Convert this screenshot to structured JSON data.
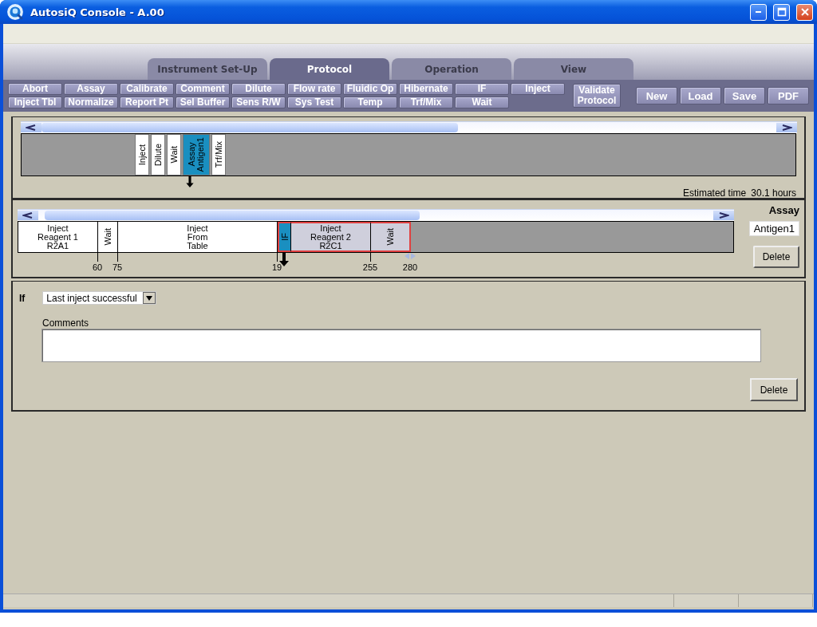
{
  "window": {
    "title": "AutosiQ Console - A.00"
  },
  "tabs": [
    {
      "label": "Instrument Set-Up",
      "selected": false
    },
    {
      "label": "Protocol",
      "selected": true
    },
    {
      "label": "Operation",
      "selected": false
    },
    {
      "label": "View",
      "selected": false
    }
  ],
  "step_buttons": [
    "Abort",
    "Assay",
    "Calibrate",
    "Comment",
    "Dilute",
    "Flow rate",
    "Fluidic Op",
    "Hibernate",
    "IF",
    "Inject",
    "Inject Tbl",
    "Normalize",
    "Report Pt",
    "Sel Buffer",
    "Sens R/W",
    "Sys Test",
    "Temp",
    "Trf/Mix",
    "Wait"
  ],
  "validate_button": "Validate Protocol",
  "file_buttons": [
    "New",
    "Load",
    "Save",
    "PDF"
  ],
  "protocol_timeline": {
    "steps": [
      {
        "lines": [
          "Inject"
        ],
        "selected": false
      },
      {
        "lines": [
          "Dilute"
        ],
        "selected": false
      },
      {
        "lines": [
          "Wait"
        ],
        "selected": false
      },
      {
        "lines": [
          "Assay",
          "Antigen1"
        ],
        "selected": true
      },
      {
        "lines": [
          "Trf/Mix"
        ],
        "selected": false
      }
    ],
    "estimated_time_label": "Estimated time",
    "estimated_time": "30.1 hours"
  },
  "assay_timeline": {
    "steps": [
      {
        "kind": "block",
        "lines": [
          "Inject",
          "Reagent 1",
          "R2A1"
        ],
        "selected": false,
        "highlighted": false,
        "end_tick": "60"
      },
      {
        "kind": "vertical",
        "lines": [
          "Wait"
        ],
        "selected": false,
        "highlighted": false,
        "end_tick": "75"
      },
      {
        "kind": "block",
        "lines": [
          "Inject",
          "From",
          "Table"
        ],
        "selected": false,
        "highlighted": false,
        "end_tick": "19"
      },
      {
        "kind": "vertical",
        "lines": [
          "IF"
        ],
        "selected": true,
        "highlighted": true
      },
      {
        "kind": "block",
        "lines": [
          "Inject",
          "Reagent 2",
          "R2C1"
        ],
        "selected": false,
        "highlighted": true,
        "end_tick": "255"
      },
      {
        "kind": "vertical",
        "lines": [
          "Wait"
        ],
        "selected": false,
        "highlighted": true,
        "end_tick": "280"
      }
    ],
    "assay_label": "Assay",
    "assay_name": "Antigen1",
    "delete_button": "Delete"
  },
  "condition": {
    "label": "If",
    "value": "Last inject successful",
    "comments_label": "Comments",
    "delete_button": "Delete"
  }
}
